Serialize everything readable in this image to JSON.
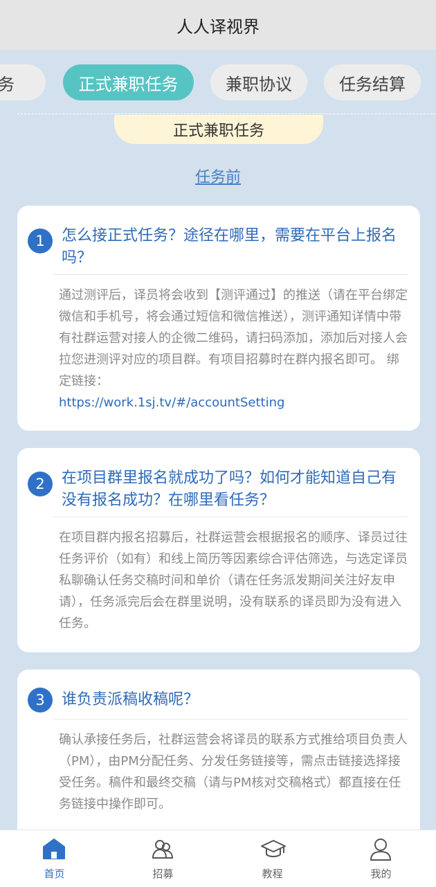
{
  "app": {
    "title": "人人译视界"
  },
  "tabs": [
    {
      "label": "任务"
    },
    {
      "label": "正式兼职任务",
      "active": true
    },
    {
      "label": "兼职协议"
    },
    {
      "label": "任务结算"
    }
  ],
  "section": {
    "title": "正式兼职任务",
    "subheading": "任务前"
  },
  "faq": [
    {
      "number": "1",
      "question": "怎么接正式任务？途径在哪里，需要在平台上报名吗？",
      "answer": "通过测评后，译员将会收到【测评通过】的推送（请在平台绑定微信和手机号，将会通过短信和微信推送），测评通知详情中带有社群运营对接人的企微二维码，请扫码添加，添加后对接人会拉您进测评对应的项目群。有项目招募时在群内报名即可。 绑定链接：",
      "link": "https://work.1sj.tv/#/accountSetting"
    },
    {
      "number": "2",
      "question": "在项目群里报名就成功了吗？如何才能知道自己有没有报名成功？在哪里看任务？",
      "answer": "在项目群内报名招募后，社群运营会根据报名的顺序、译员过往任务评价（如有）和线上简历等因素综合评估筛选，与选定译员私聊确认任务交稿时间和单价（请在任务派发期间关注好友申请），任务派完后会在群里说明，没有联系的译员即为没有进入任务。"
    },
    {
      "number": "3",
      "question": "谁负责派稿收稿呢？",
      "answer": "确认承接任务后，社群运营会将译员的联系方式推给项目负责人（PM），由PM分配任务、分发任务链接等，需点击链接选择接受任务。稿件和最终交稿（请与PM核对交稿格式）都直接在任务链接中操作即可。"
    }
  ],
  "bottom_nav": [
    {
      "label": "首页",
      "icon": "home-icon",
      "active": true
    },
    {
      "label": "招募",
      "icon": "recruit-icon"
    },
    {
      "label": "教程",
      "icon": "graduation-cap-icon"
    },
    {
      "label": "我的",
      "icon": "user-icon"
    }
  ],
  "colors": {
    "background": "#d3e1ee",
    "active_tab": "#57c4c4",
    "accent_blue": "#2f71c6",
    "question_text": "#2e6bb8",
    "section_pill": "#fdf5d6"
  }
}
